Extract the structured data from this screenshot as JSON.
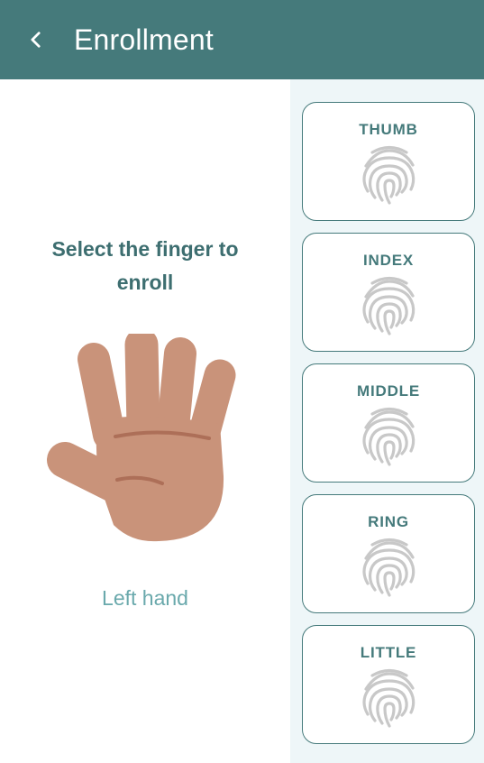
{
  "header": {
    "title": "Enrollment",
    "back_icon": "chevron-left-icon",
    "background_color": "#457a7b"
  },
  "main": {
    "prompt": "Select the finger to enroll",
    "hand_icon": "left-hand-illustration",
    "hand_label": "Left hand",
    "hand_color": "#c9937a"
  },
  "fingers": [
    {
      "label": "THUMB",
      "icon": "fingerprint-icon"
    },
    {
      "label": "INDEX",
      "icon": "fingerprint-icon"
    },
    {
      "label": "MIDDLE",
      "icon": "fingerprint-icon"
    },
    {
      "label": "RING",
      "icon": "fingerprint-icon"
    },
    {
      "label": "LITTLE",
      "icon": "fingerprint-icon"
    }
  ],
  "colors": {
    "accent": "#457a7b",
    "prompt_text": "#3d6e70",
    "label_text": "#6aa9ac",
    "side_panel": "#eef6f8"
  }
}
